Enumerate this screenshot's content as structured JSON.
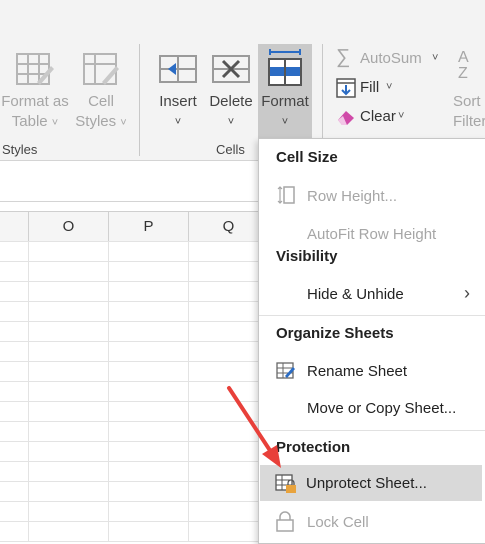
{
  "ribbon": {
    "format_as_table": [
      "Format as",
      "Table"
    ],
    "cell_styles": [
      "Cell",
      "Styles"
    ],
    "styles_group": "Styles",
    "insert": "Insert",
    "delete": "Delete",
    "format": "Format",
    "cells_group": "Cells",
    "autosum": "AutoSum",
    "fill": "Fill",
    "clear": "Clear",
    "sort_filter": [
      "Sort",
      "Filter"
    ]
  },
  "columns": [
    "O",
    "P",
    "Q"
  ],
  "menu": {
    "cell_size_header": "Cell Size",
    "row_height": "Row Height...",
    "autofit_row_height": "AutoFit Row Height",
    "visibility_header": "Visibility",
    "hide_unhide": "Hide & Unhide",
    "organize_header": "Organize Sheets",
    "rename_sheet": "Rename Sheet",
    "move_copy_sheet": "Move or Copy Sheet...",
    "protection_header": "Protection",
    "unprotect_sheet": "Unprotect Sheet...",
    "lock_cell": "Lock Cell"
  },
  "colors": {
    "arrow": "#e8403a",
    "highlight": "#d9d9d9",
    "accent_blue": "#2b6cc4",
    "lock_orange": "#e8a33d"
  }
}
